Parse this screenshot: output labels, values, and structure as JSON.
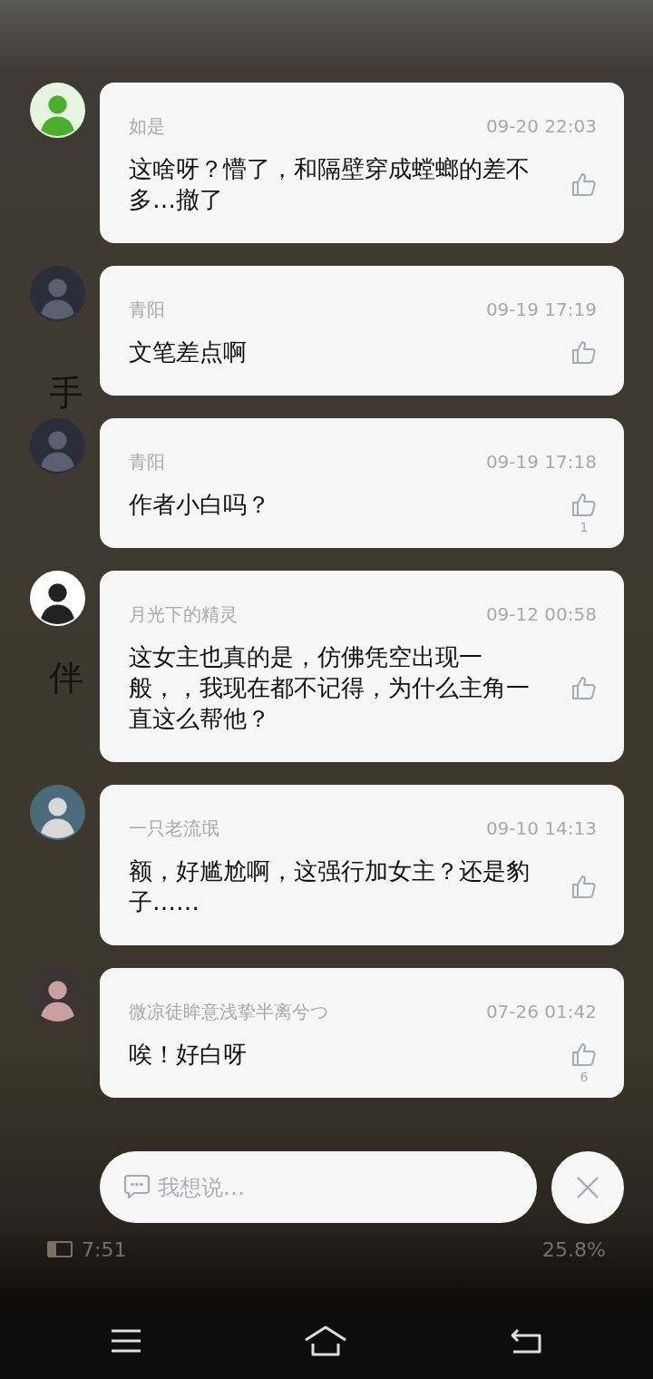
{
  "reader_background": {
    "fragments": [
      "手",
      "伴"
    ],
    "status_bar": {
      "time": "7:51",
      "progress": "25.8%"
    }
  },
  "comments": [
    {
      "user": "如是",
      "time": "09-20 22:03",
      "text": "这啥呀？懵了，和隔壁穿成螳螂的差不多…撤了"
    },
    {
      "user": "青阳",
      "time": "09-19 17:19",
      "text": "文笔差点啊"
    },
    {
      "user": "青阳",
      "time": "09-19 17:18",
      "text": "作者小白吗？",
      "likes": "1"
    },
    {
      "user": "月光下的精灵",
      "time": "09-12 00:58",
      "text": "这女主也真的是，仿佛凭空出现一般，，我现在都不记得，为什么主角一直这么帮他？"
    },
    {
      "user": "一只老流氓",
      "time": "09-10 14:13",
      "text": "额，好尴尬啊，这强行加女主？还是豹子……"
    },
    {
      "user": "微凉徒眸意浅挚半离兮つ",
      "time": "07-26 01:42",
      "text": "唉！好白呀",
      "likes": "6"
    }
  ],
  "input": {
    "placeholder": "我想说…"
  }
}
